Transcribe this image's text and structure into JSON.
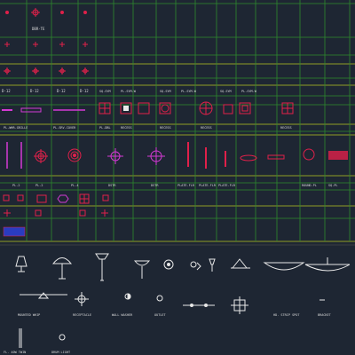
{
  "colors": {
    "background": "#1e2633",
    "grid_line": "#2e8b2e",
    "grid_line_bright": "#b7c720",
    "divider": "#c8c8c8",
    "symbol_red": "#e0204a",
    "symbol_magenta": "#d43ad4",
    "symbol_white": "#e8e8e8",
    "symbol_blue": "#2a3cc0",
    "label_white": "#dcdcdc",
    "label_red": "#e0204a"
  },
  "top_labels": {
    "row1_header": "DBR-TE",
    "row3_items": [
      "D-12",
      "D-12",
      "D-12",
      "D-12"
    ],
    "row4_items": [
      "SQ-SYM",
      "PL-SYM-W",
      "SQ-SYM",
      "PL-SYM-W",
      "SQ-SYM",
      "PL-SYM-W"
    ]
  },
  "wall_row_labels": [
    "PL-WHR-GRILLE",
    "PL-SRV-COVER",
    "PL-DBL",
    "RECESS",
    "RECESS",
    "RECESS",
    "RECESS"
  ],
  "lower_row_labels": [
    "PL-2",
    "PL-2",
    "PL-4",
    "DSTR",
    "DSTR",
    "PLATE-FLR",
    "PLATE-FLR",
    "PLATE-FLR",
    "ROUND-PL",
    "SQ-PL"
  ],
  "bottom_labels": {
    "row1": [
      "MOUNTED WHIP",
      "RECEPTACLE",
      "WALL WASHER",
      "OUTLET",
      "",
      "",
      "HD. STRIP SPOT",
      "BRACKET"
    ],
    "row2": [
      "FL. 40W TWIN",
      "DRUM LIGHT"
    ]
  }
}
